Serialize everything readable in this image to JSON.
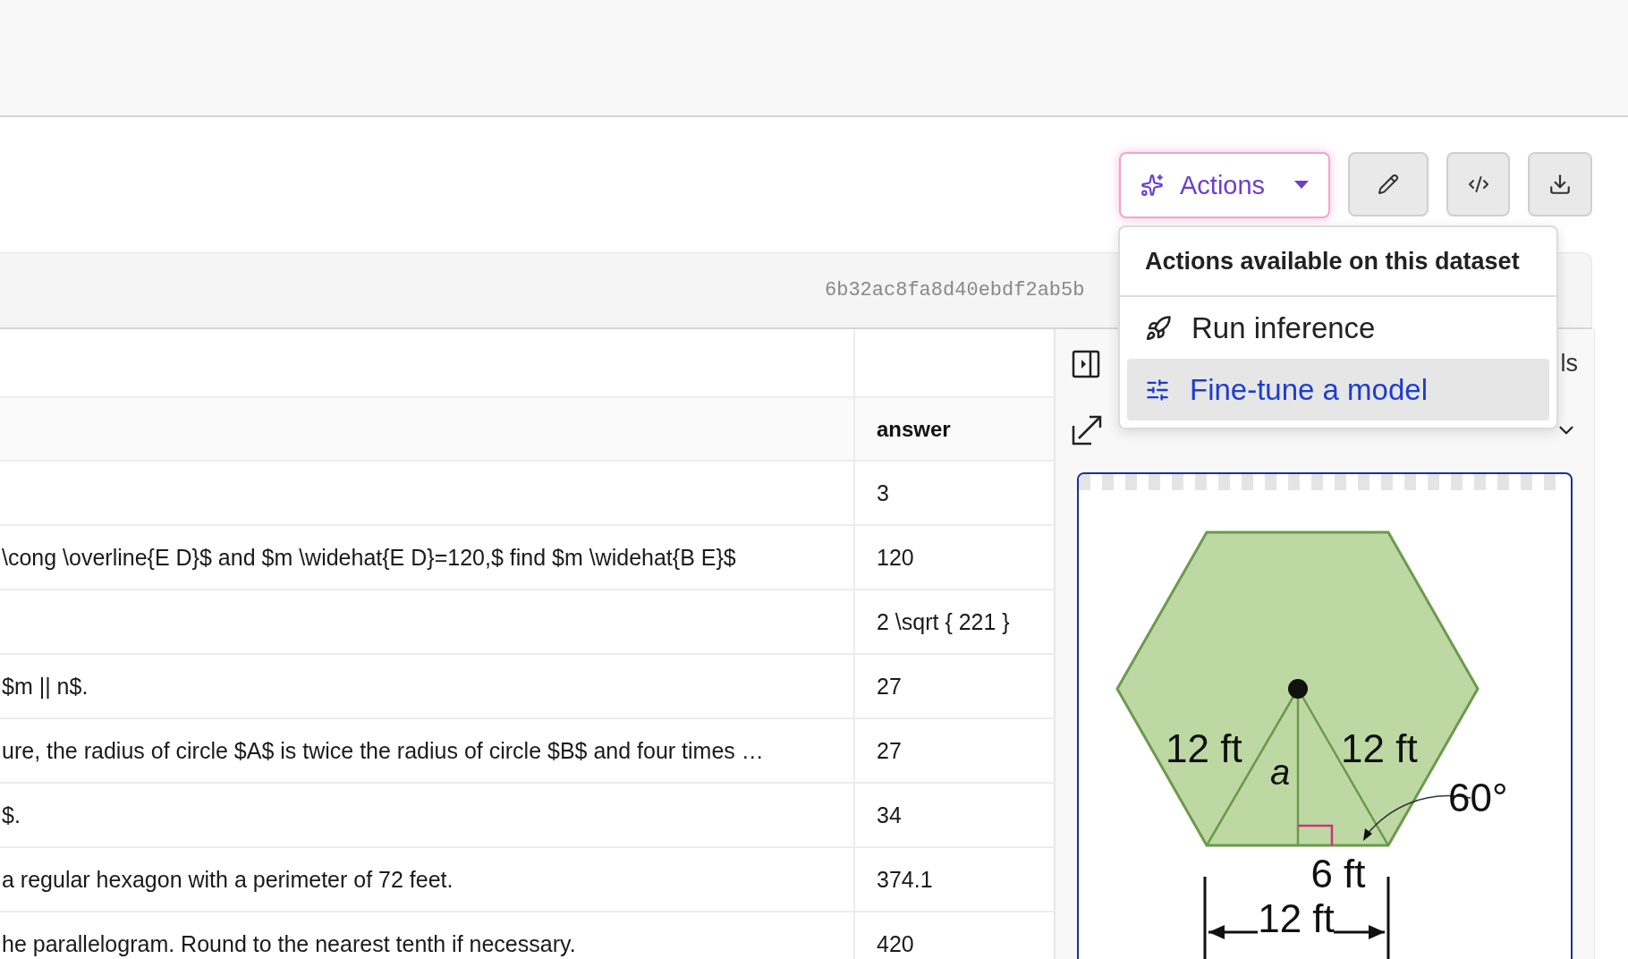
{
  "toolbar": {
    "actions_button": {
      "label": "Actions"
    }
  },
  "commit_hash": "6b32ac8fa8d40ebdf2ab5b",
  "actions_menu": {
    "title": "Actions available on this dataset",
    "items": [
      {
        "label": "Run inference",
        "kind": "rocket",
        "selected": false
      },
      {
        "label": "Fine-tune a model",
        "kind": "sliders",
        "selected": true
      }
    ]
  },
  "table": {
    "answer_column": "answer",
    "rows": [
      {
        "answer": "3"
      },
      {
        "question": "\\cong \\overline{E D}$ and $m \\widehat{E D}=120,$ find $m \\widehat{B E}$",
        "answer": "120"
      },
      {
        "answer": "2 \\sqrt { 221 }"
      },
      {
        "question": "$m || n$.",
        "answer": "27"
      },
      {
        "question": "ure, the radius of circle $A$ is twice the radius of circle $B$ and four times …",
        "answer": "27"
      },
      {
        "question": "$.",
        "answer": "34"
      },
      {
        "question": "a regular hexagon with a perimeter of 72 feet.",
        "answer": "374.1"
      },
      {
        "question": "he parallelogram. Round to the nearest tenth if necessary.",
        "answer": "420"
      }
    ]
  },
  "side_panel": {
    "header_text": "ls",
    "figure": {
      "labels": [
        "12 ft",
        "12 ft",
        "a",
        "60°",
        "6 ft",
        "12 ft"
      ]
    }
  }
}
